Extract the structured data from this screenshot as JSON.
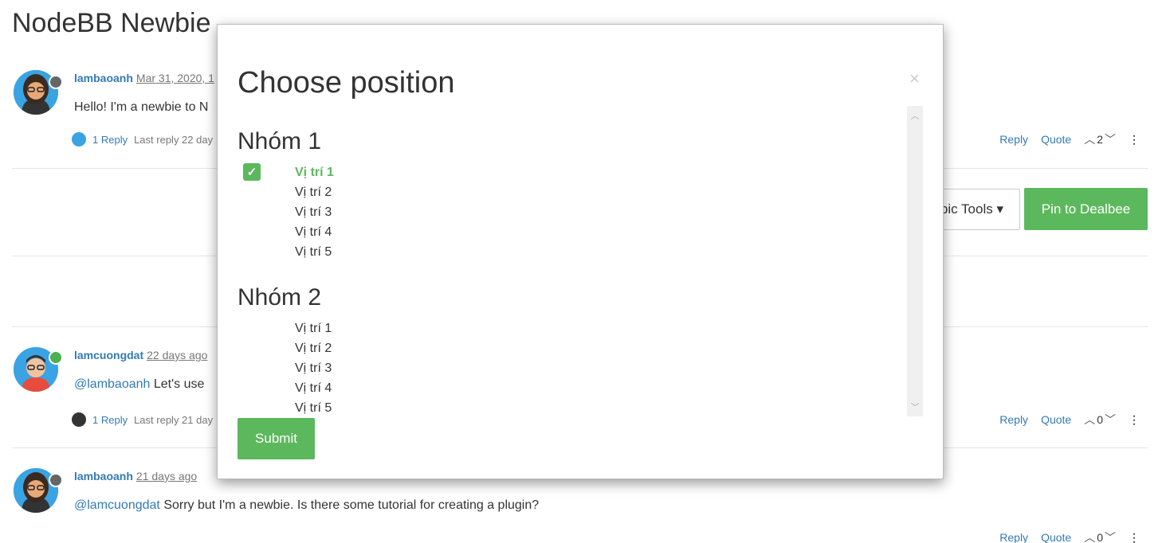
{
  "topic": {
    "title": "NodeBB Newbie"
  },
  "posts": [
    {
      "author": "lambaoanh",
      "time": "Mar 31, 2020, 1",
      "content": "Hello! I'm a newbie to N",
      "replies_label": "1 Reply",
      "last_reply": "Last reply 22 day",
      "votes": "2",
      "status": "away"
    },
    {
      "author": "lamcuongdat",
      "time": "22 days ago",
      "mention": "@lambaoanh",
      "content": "Let's use",
      "replies_label": "1 Reply",
      "last_reply": "Last reply 21 day",
      "votes": "0",
      "status": "online"
    },
    {
      "author": "lambaoanh",
      "time": "21 days ago",
      "mention": "@lamcuongdat",
      "content": "Sorry but I'm a newbie. Is there some tutorial for creating a plugin?",
      "votes": "0",
      "status": "away"
    }
  ],
  "actions": {
    "reply": "Reply",
    "quote": "Quote"
  },
  "toolbar": {
    "topic_tools": "pic Tools ▾",
    "pin": "Pin to Dealbee"
  },
  "modal": {
    "title": "Choose position",
    "close": "×",
    "groups": [
      {
        "name": "Nhóm 1",
        "positions": [
          "Vị trí 1",
          "Vị trí 2",
          "Vị trí 3",
          "Vị trí 4",
          "Vị trí 5"
        ],
        "selected_index": 0
      },
      {
        "name": "Nhóm 2",
        "positions": [
          "Vị trí 1",
          "Vị trí 2",
          "Vị trí 3",
          "Vị trí 4",
          "Vị trí 5"
        ],
        "selected_index": -1
      }
    ],
    "submit": "Submit"
  },
  "colors": {
    "accent": "#5cb85c",
    "link": "#337ab7",
    "online": "#4caf50",
    "away": "#666666"
  }
}
